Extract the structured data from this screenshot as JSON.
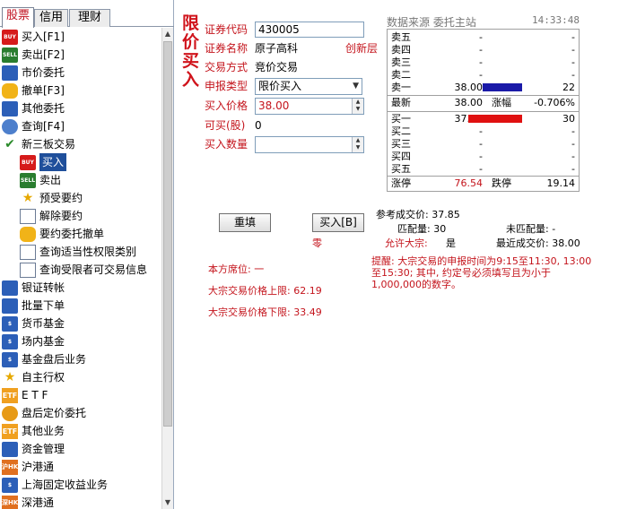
{
  "tabs": [
    "股票",
    "信用",
    "理财"
  ],
  "tree": [
    {
      "label": "买入[F1]",
      "icon": "buy-icon",
      "icon_text": "BUY"
    },
    {
      "label": "卖出[F2]",
      "icon": "sell-icon",
      "icon_text": "SELL"
    },
    {
      "label": "市价委托",
      "icon": "market-order-icon",
      "icon_text": ""
    },
    {
      "label": "撤单[F3]",
      "icon": "cancel-hand-icon",
      "icon_text": ""
    },
    {
      "label": "其他委托",
      "icon": "other-order-icon",
      "icon_text": ""
    },
    {
      "label": "查询[F4]",
      "icon": "query-magnifier-icon",
      "icon_text": ""
    },
    {
      "label": "新三板交易",
      "icon": "checkmark-icon",
      "icon_text": "✔"
    },
    {
      "label": "买入",
      "icon": "buy-icon",
      "icon_text": "BUY"
    },
    {
      "label": "卖出",
      "icon": "sell-icon",
      "icon_text": "SELL"
    },
    {
      "label": "预受要约",
      "icon": "document-star-icon",
      "icon_text": "★"
    },
    {
      "label": "解除要约",
      "icon": "document-edit-icon",
      "icon_text": ""
    },
    {
      "label": "要约委托撤单",
      "icon": "cancel-hand-icon",
      "icon_text": ""
    },
    {
      "label": "查询适当性权限类别",
      "icon": "document-icon",
      "icon_text": ""
    },
    {
      "label": "查询受限者可交易信息",
      "icon": "document-icon",
      "icon_text": ""
    },
    {
      "label": "银证转帐",
      "icon": "bank-transfer-icon",
      "icon_text": ""
    },
    {
      "label": "批量下单",
      "icon": "batch-order-icon",
      "icon_text": ""
    },
    {
      "label": "货币基金",
      "icon": "fund-icon",
      "icon_text": "$"
    },
    {
      "label": "场内基金",
      "icon": "fund-icon",
      "icon_text": "$"
    },
    {
      "label": "基金盘后业务",
      "icon": "fund-icon",
      "icon_text": "$"
    },
    {
      "label": "自主行权",
      "icon": "star-icon",
      "icon_text": "★"
    },
    {
      "label": "E T F",
      "icon": "etf-icon",
      "icon_text": "ETF"
    },
    {
      "label": "盘后定价委托",
      "icon": "clock-icon",
      "icon_text": ""
    },
    {
      "label": "其他业务",
      "icon": "etf-icon",
      "icon_text": "ETF"
    },
    {
      "label": "资金管理",
      "icon": "money-icon",
      "icon_text": ""
    },
    {
      "label": "沪港通",
      "icon": "hk-connect-icon",
      "icon_text": "沪HK"
    },
    {
      "label": "上海固定收益业务",
      "icon": "fund-icon",
      "icon_text": "$"
    },
    {
      "label": "深港通",
      "icon": "hk-connect-icon",
      "icon_text": "深HK"
    }
  ],
  "order": {
    "title": "限价买入",
    "code_label": "证券代码",
    "code_value": "430005",
    "name_label": "证券名称",
    "name_value": "原子高科",
    "tier": "创新层",
    "method_label": "交易方式",
    "method_value": "竞价交易",
    "type_label": "申报类型",
    "type_value": "限价买入",
    "price_label": "买入价格",
    "price_value": "38.00",
    "available_label": "可买(股)",
    "available_value": "0",
    "qty_label": "买入数量",
    "qty_value": "",
    "reset_btn": "重填",
    "buy_btn": "买入[B]",
    "zero_text": "零"
  },
  "quote": {
    "source": "数据来源  委托主站",
    "time": "14:33:48",
    "asks": [
      {
        "label": "卖五",
        "price": "-",
        "vol": "-"
      },
      {
        "label": "卖四",
        "price": "-",
        "vol": "-"
      },
      {
        "label": "卖三",
        "price": "-",
        "vol": "-"
      },
      {
        "label": "卖二",
        "price": "-",
        "vol": "-"
      },
      {
        "label": "卖一",
        "price": "38.00",
        "vol": "22"
      }
    ],
    "latest_label": "最新",
    "latest_value": "38.00",
    "change_label": "涨幅",
    "change_value": "-0.706%",
    "bids": [
      {
        "label": "买一",
        "price": "37.85",
        "vol": "30"
      },
      {
        "label": "买二",
        "price": "-",
        "vol": "-"
      },
      {
        "label": "买三",
        "price": "-",
        "vol": "-"
      },
      {
        "label": "买四",
        "price": "-",
        "vol": "-"
      },
      {
        "label": "买五",
        "price": "-",
        "vol": "-"
      }
    ],
    "up_limit_label": "涨停",
    "up_limit_value": "76.54",
    "down_limit_label": "跌停",
    "down_limit_value": "19.14",
    "colors": {
      "ask_bar": "#1a1aa8",
      "bid_bar": "#e01010",
      "up": "#c4141c"
    }
  },
  "info": {
    "ref_price": "参考成交价: 37.85",
    "matched": "匹配量: 30",
    "unmatched": "未匹配量: -",
    "allow_block_label": "允许大宗:",
    "allow_block_value": "是",
    "last_price": "最近成交价: 38.00",
    "seat": "本方席位: 一",
    "block_upper": "大宗交易价格上限: 62.19",
    "block_lower": "大宗交易价格下限: 33.49",
    "remark": "提醒: 大宗交易的申报时间为9:15至11:30, 13:00至15:30; 其中, 约定号必须填写且为小于1,000,000的数字。"
  }
}
